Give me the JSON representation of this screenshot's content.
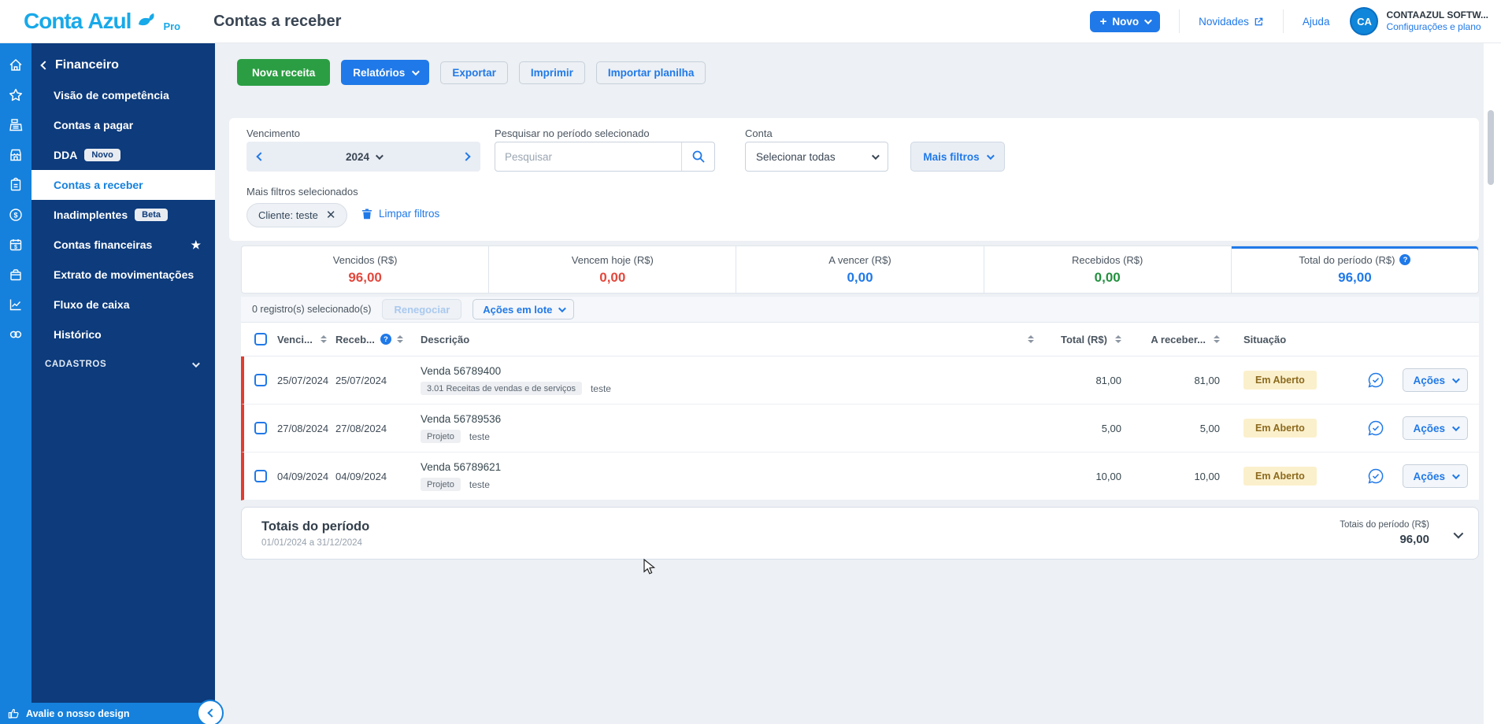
{
  "colors": {
    "accent_blue": "#2079e8",
    "brand_blue": "#18a9e9",
    "sidebar_navy": "#0d3b7c",
    "sidebar_blue": "#1581dc",
    "success_green": "#2b9e43",
    "overdue_red": "#e23c30"
  },
  "header": {
    "logo_conta": "Conta",
    "logo_azul": "Azul",
    "logo_pro": "Pro",
    "page_title": "Contas a receber",
    "novo_button": "Novo",
    "novidades": "Novidades",
    "ajuda": "Ajuda",
    "avatar_initials": "CA",
    "account_name": "CONTAAZUL SOFTW...",
    "account_link": "Configurações e plano"
  },
  "sidebar": {
    "back_section": "Financeiro",
    "items": [
      {
        "label": "Visão de competência"
      },
      {
        "label": "Contas a pagar"
      },
      {
        "label": "DDA",
        "badge": "Novo"
      },
      {
        "label": "Contas a receber"
      },
      {
        "label": "Inadimplentes",
        "badge": "Beta"
      },
      {
        "label": "Contas financeiras"
      },
      {
        "label": "Extrato de movimentações"
      },
      {
        "label": "Fluxo de caixa"
      },
      {
        "label": "Histórico"
      }
    ],
    "cadastros_label": "CADASTROS",
    "rate_design_label": "Avalie o nosso design"
  },
  "toolbar": {
    "nova_receita": "Nova receita",
    "relatorios": "Relatórios",
    "exportar": "Exportar",
    "imprimir": "Imprimir",
    "importar_planilha": "Importar planilha"
  },
  "filters": {
    "vencimento_label": "Vencimento",
    "year": "2024",
    "search_label": "Pesquisar no período selecionado",
    "search_placeholder": "Pesquisar",
    "conta_label": "Conta",
    "conta_value": "Selecionar todas",
    "mais_filtros": "Mais filtros",
    "selected_label": "Mais filtros selecionados",
    "chip": "Cliente: teste",
    "limpar": "Limpar filtros"
  },
  "summary_cards": [
    {
      "label": "Vencidos (R$)",
      "value": "96,00",
      "color": "#e2483d"
    },
    {
      "label": "Vencem hoje (R$)",
      "value": "0,00",
      "color": "#e2483d"
    },
    {
      "label": "A vencer (R$)",
      "value": "0,00",
      "color": "#2079e8"
    },
    {
      "label": "Recebidos (R$)",
      "value": "0,00",
      "color": "#23913f"
    },
    {
      "label": "Total do período (R$)",
      "value": "96,00",
      "color": "#2079e8"
    }
  ],
  "selection_bar": {
    "selected_text": "0 registro(s) selecionado(s)",
    "renegociar": "Renegociar",
    "acoes_lote": "Ações em lote"
  },
  "table": {
    "headers": {
      "venc": "Venci...",
      "receb": "Receb...",
      "desc": "Descrição",
      "total": "Total (R$)",
      "areceber": "A receber...",
      "situacao": "Situação"
    },
    "rows": [
      {
        "venc": "25/07/2024",
        "receb": "25/07/2024",
        "desc": "Venda 56789400",
        "tag": "3.01 Receitas de vendas e de serviços",
        "tag2": "teste",
        "total": "81,00",
        "areceber": "81,00",
        "situacao": "Em Aberto",
        "acoes": "Ações"
      },
      {
        "venc": "27/08/2024",
        "receb": "27/08/2024",
        "desc": "Venda 56789536",
        "tag": "Projeto",
        "tag2": "teste",
        "total": "5,00",
        "areceber": "5,00",
        "situacao": "Em Aberto",
        "acoes": "Ações"
      },
      {
        "venc": "04/09/2024",
        "receb": "04/09/2024",
        "desc": "Venda 56789621",
        "tag": "Projeto",
        "tag2": "teste",
        "total": "10,00",
        "areceber": "10,00",
        "situacao": "Em Aberto",
        "acoes": "Ações"
      }
    ]
  },
  "totals": {
    "title": "Totais do período",
    "range": "01/01/2024 a 31/12/2024",
    "right_label": "Totais do período (R$)",
    "right_value": "96,00"
  }
}
